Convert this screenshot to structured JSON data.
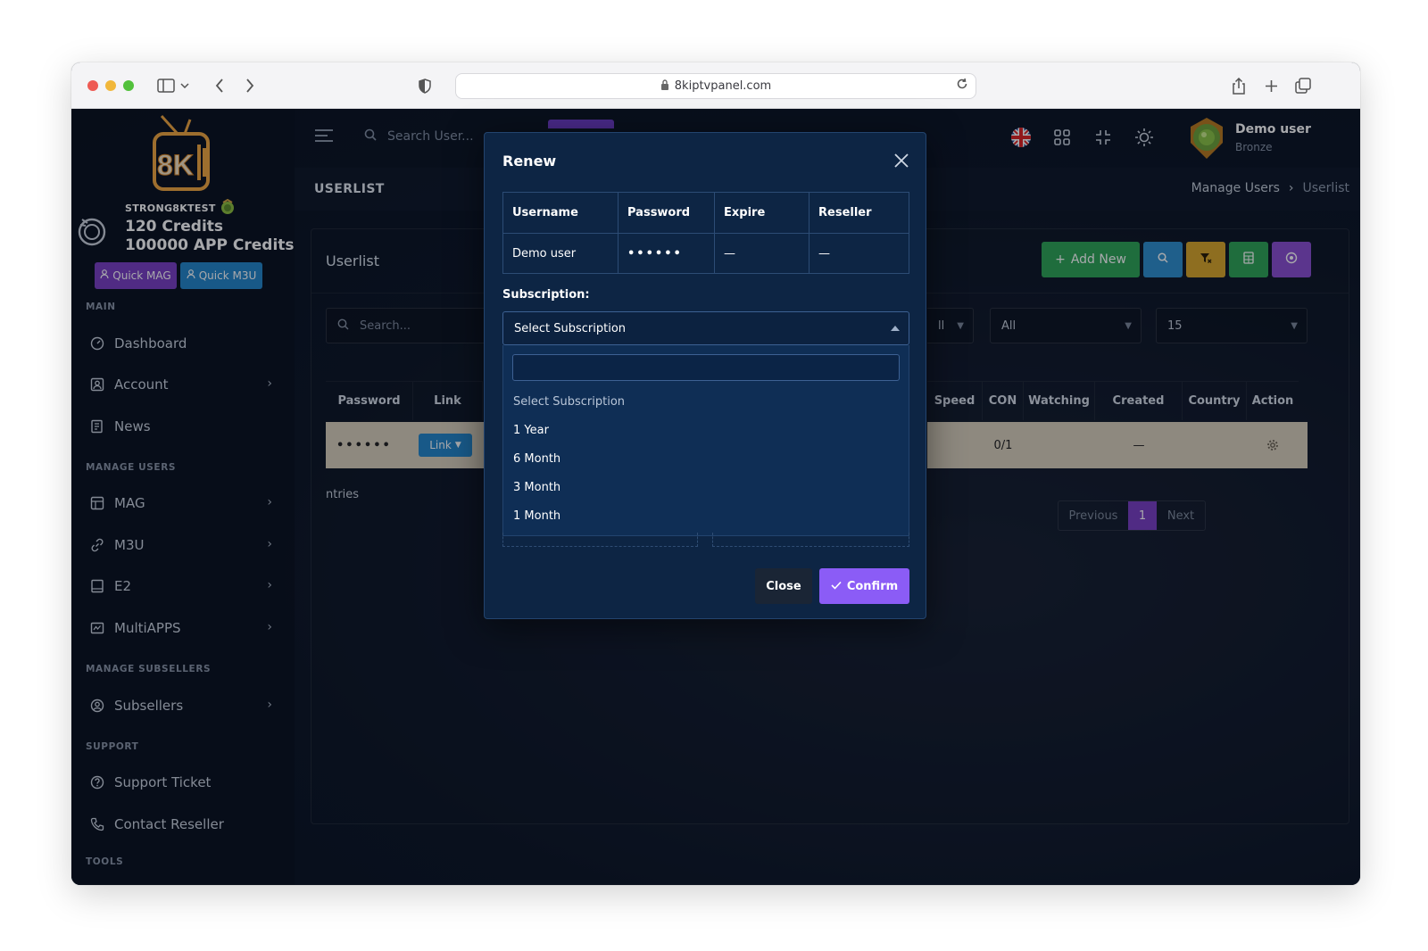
{
  "browser": {
    "url": "8kiptvpanel.com"
  },
  "sidebar": {
    "username": "STRONG8KTEST",
    "credits": "120 Credits",
    "app_credits": "100000 APP Credits",
    "quick_mag": "Quick MAG",
    "quick_m3u": "Quick M3U",
    "sections": {
      "main": "MAIN",
      "manage_users": "MANAGE USERS",
      "manage_subsellers": "MANAGE SUBSELLERS",
      "support": "SUPPORT",
      "tools": "TOOLS"
    },
    "items": [
      {
        "label": "Dashboard"
      },
      {
        "label": "Account"
      },
      {
        "label": "News"
      },
      {
        "label": "MAG"
      },
      {
        "label": "M3U"
      },
      {
        "label": "E2"
      },
      {
        "label": "MultiAPPS"
      },
      {
        "label": "Subsellers"
      },
      {
        "label": "Support Ticket"
      },
      {
        "label": "Contact Reseller"
      }
    ]
  },
  "topbar": {
    "search_placeholder": "Search User...",
    "user_name": "Demo user",
    "user_rank": "Bronze"
  },
  "page": {
    "title": "USERLIST",
    "breadcrumb": [
      "Manage Users",
      "Userlist"
    ]
  },
  "card": {
    "title": "Userlist",
    "add_new": "Add New",
    "search_placeholder": "Search...",
    "filter_1": "ll",
    "filter_2": "All",
    "filter_3": "15",
    "entries_text": "ntries",
    "columns_left": [
      "Password",
      "Link"
    ],
    "columns_right": [
      "Speed",
      "CON",
      "Watching",
      "Created",
      "Country",
      "Action"
    ],
    "row": {
      "password": "••••••",
      "link": "Link",
      "con": "0/1",
      "created": "—"
    },
    "pager": {
      "previous": "Previous",
      "current": "1",
      "next": "Next"
    }
  },
  "modal": {
    "title": "Renew",
    "table_headers": [
      "Username",
      "Password",
      "Expire",
      "Reseller"
    ],
    "table_row": [
      "Demo user",
      "••••••",
      "—",
      "—"
    ],
    "subscription_label": "Subscription:",
    "selected": "Select Subscription",
    "options": [
      "Select Subscription",
      "1 Year",
      "6 Month",
      "3 Month",
      "1 Month"
    ],
    "close_label": "Close",
    "confirm_label": "Confirm"
  },
  "colors": {
    "add_new": "#2fa556",
    "search": "#2f8fce",
    "filter": "#d9a62a",
    "export": "#2fa556",
    "settings": "#8b4fd1",
    "confirm": "#8b5cf6",
    "quick_mag": "#7a3fc4",
    "quick_m3u": "#2486c9"
  }
}
